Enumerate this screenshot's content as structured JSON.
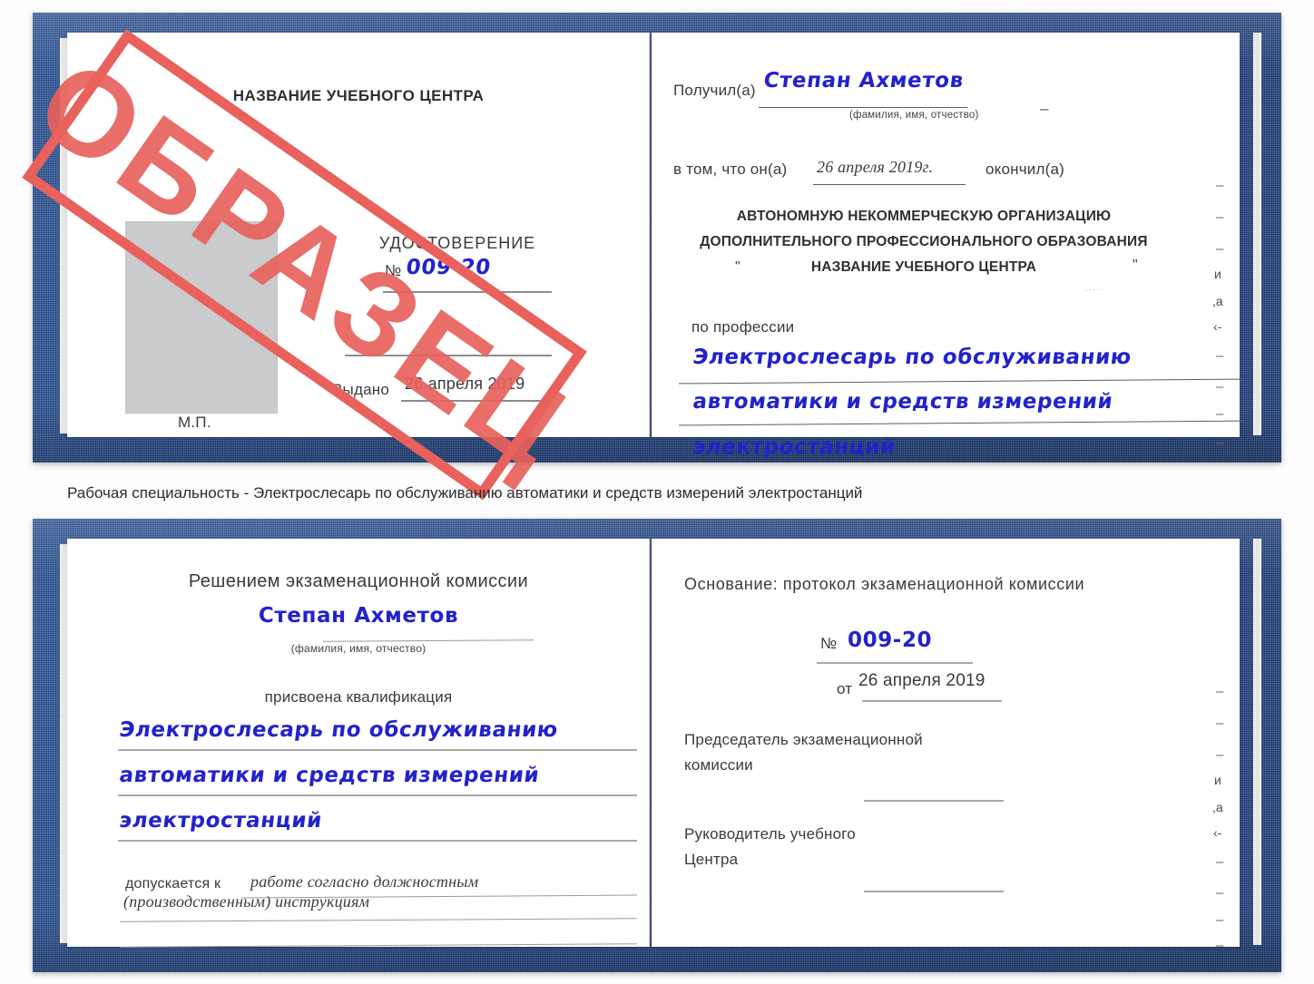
{
  "document": {
    "type": "certificate-scan",
    "stamp": {
      "label": "ОБРАЗЕЦ",
      "color": "#e8615c"
    },
    "ink_color": "#2222cc",
    "cover_color": "#1f4484"
  },
  "caption": {
    "text": "Рабочая специальность - Электрослесарь по обслуживанию автоматики и средств измерений электростанций"
  },
  "top_certificate": {
    "left_page": {
      "center_name": "НАЗВАНИЕ УЧЕБНОГО ЦЕНТРА",
      "doc_title": "УДОСТОВЕРЕНИЕ",
      "number_label": "№",
      "number_value": "009-20",
      "issued_label": "Выдано",
      "issued_value": "26 апреля 2019",
      "seal_label": "М.П.",
      "photo_placeholder": "photo-placeholder"
    },
    "right_page": {
      "received_label": "Получил(а)",
      "received_value": "Степан Ахметов",
      "fio_hint": "(фамилия, имя, отчество)",
      "that_he_label": "в том, что он(а)",
      "completion_date": "26 апреля 2019г.",
      "finished_label": "окончил(а)",
      "org_line1": "АВТОНОМНУЮ НЕКОММЕРЧЕСКУЮ ОРГАНИЗАЦИЮ",
      "org_line2": "ДОПОЛНИТЕЛЬНОГО ПРОФЕССИОНАЛЬНОГО ОБРАЗОВАНИЯ",
      "org_quote_open": "\"",
      "org_line3": "НАЗВАНИЕ УЧЕБНОГО ЦЕНТРА",
      "org_quote_close": "\"",
      "profession_label": "по профессии",
      "profession_line1": "Электрослесарь по обслуживанию",
      "profession_line2": "автоматики и средств измерений",
      "profession_line3": "электростанций",
      "margin_ghost": [
        "–",
        "–",
        "–",
        "и",
        ",а",
        "‹-",
        "–",
        "–",
        "–",
        "–"
      ]
    }
  },
  "bottom_certificate": {
    "left_page": {
      "heading": "Решением экзаменационной комиссии",
      "name_value": "Степан Ахметов",
      "fio_hint": "(фамилия, имя, отчество)",
      "qualification_label": "присвоена квалификация",
      "qualification_line1": "Электрослесарь по обслуживанию",
      "qualification_line2": "автоматики и средств измерений",
      "qualification_line3": "электростанций",
      "admitted_label": "допускается к",
      "admitted_value_line1": "работе согласно должностным",
      "admitted_value_line2": "(производственным) инструкциям"
    },
    "right_page": {
      "basis_label": "Основание: протокол экзаменационной комиссии",
      "number_label": "№",
      "number_value": "009-20",
      "date_label": "от",
      "date_value": "26 апреля 2019",
      "chairman_line1": "Председатель экзаменационной",
      "chairman_line2": "комиссии",
      "head_line1": "Руководитель учебного",
      "head_line2": "Центра",
      "margin_ghost": [
        "–",
        "–",
        "–",
        "и",
        ",а",
        "‹-",
        "–",
        "–",
        "–",
        "–"
      ]
    }
  }
}
